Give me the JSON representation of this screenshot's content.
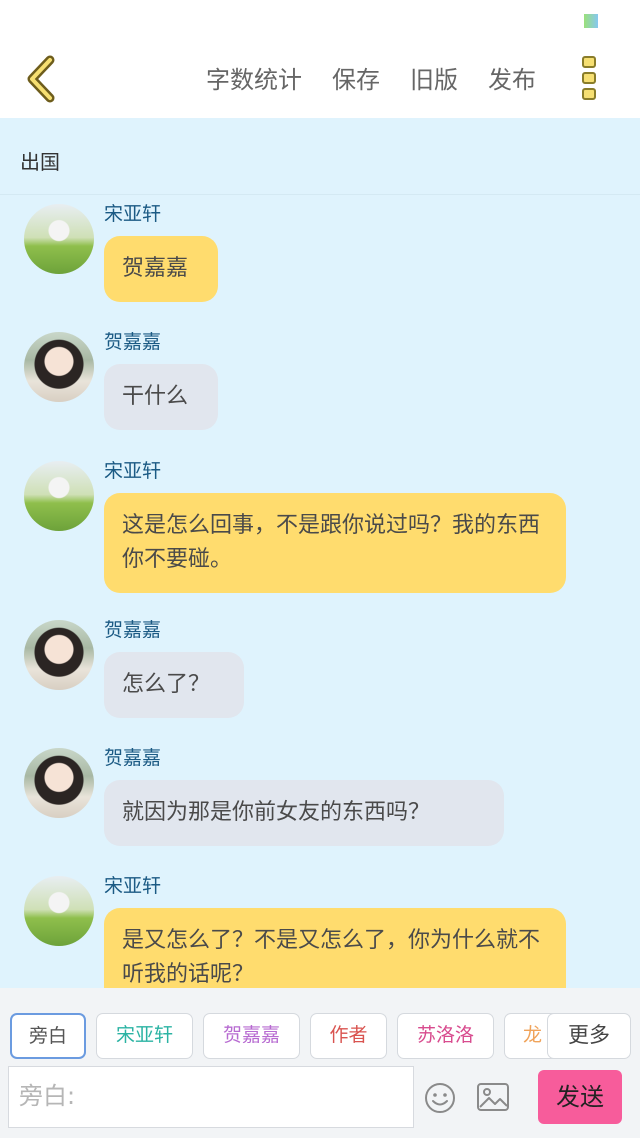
{
  "toolbar": {
    "actions": [
      "字数统计",
      "保存",
      "旧版",
      "发布"
    ]
  },
  "chat": {
    "title": "出国",
    "messages": [
      {
        "name": "宋亚轩",
        "text": "贺嘉嘉",
        "side": "character-a"
      },
      {
        "name": "贺嘉嘉",
        "text": "干什么",
        "side": "character-b"
      },
      {
        "name": "宋亚轩",
        "text": "这是怎么回事，不是跟你说过吗？我的东西你不要碰。",
        "side": "character-a"
      },
      {
        "name": "贺嘉嘉",
        "text": "怎么了？",
        "side": "character-b"
      },
      {
        "name": "贺嘉嘉",
        "text": "就因为那是你前女友的东西吗？",
        "side": "character-b"
      },
      {
        "name": "宋亚轩",
        "text": "是又怎么了？不是又怎么了，你为什么就不听我的话呢？",
        "side": "character-a"
      }
    ]
  },
  "roles": [
    {
      "label": "旁白",
      "color": "#555555"
    },
    {
      "label": "宋亚轩",
      "color": "#2bb3a3"
    },
    {
      "label": "贺嘉嘉",
      "color": "#b76bd1"
    },
    {
      "label": "作者",
      "color": "#d9534f"
    },
    {
      "label": "苏洛洛",
      "color": "#d84b8e"
    },
    {
      "label": "龙哥",
      "color": "#f0a35a"
    }
  ],
  "more_roles_label": "更多",
  "composer": {
    "placeholder": "旁白:",
    "send_label": "发送"
  }
}
